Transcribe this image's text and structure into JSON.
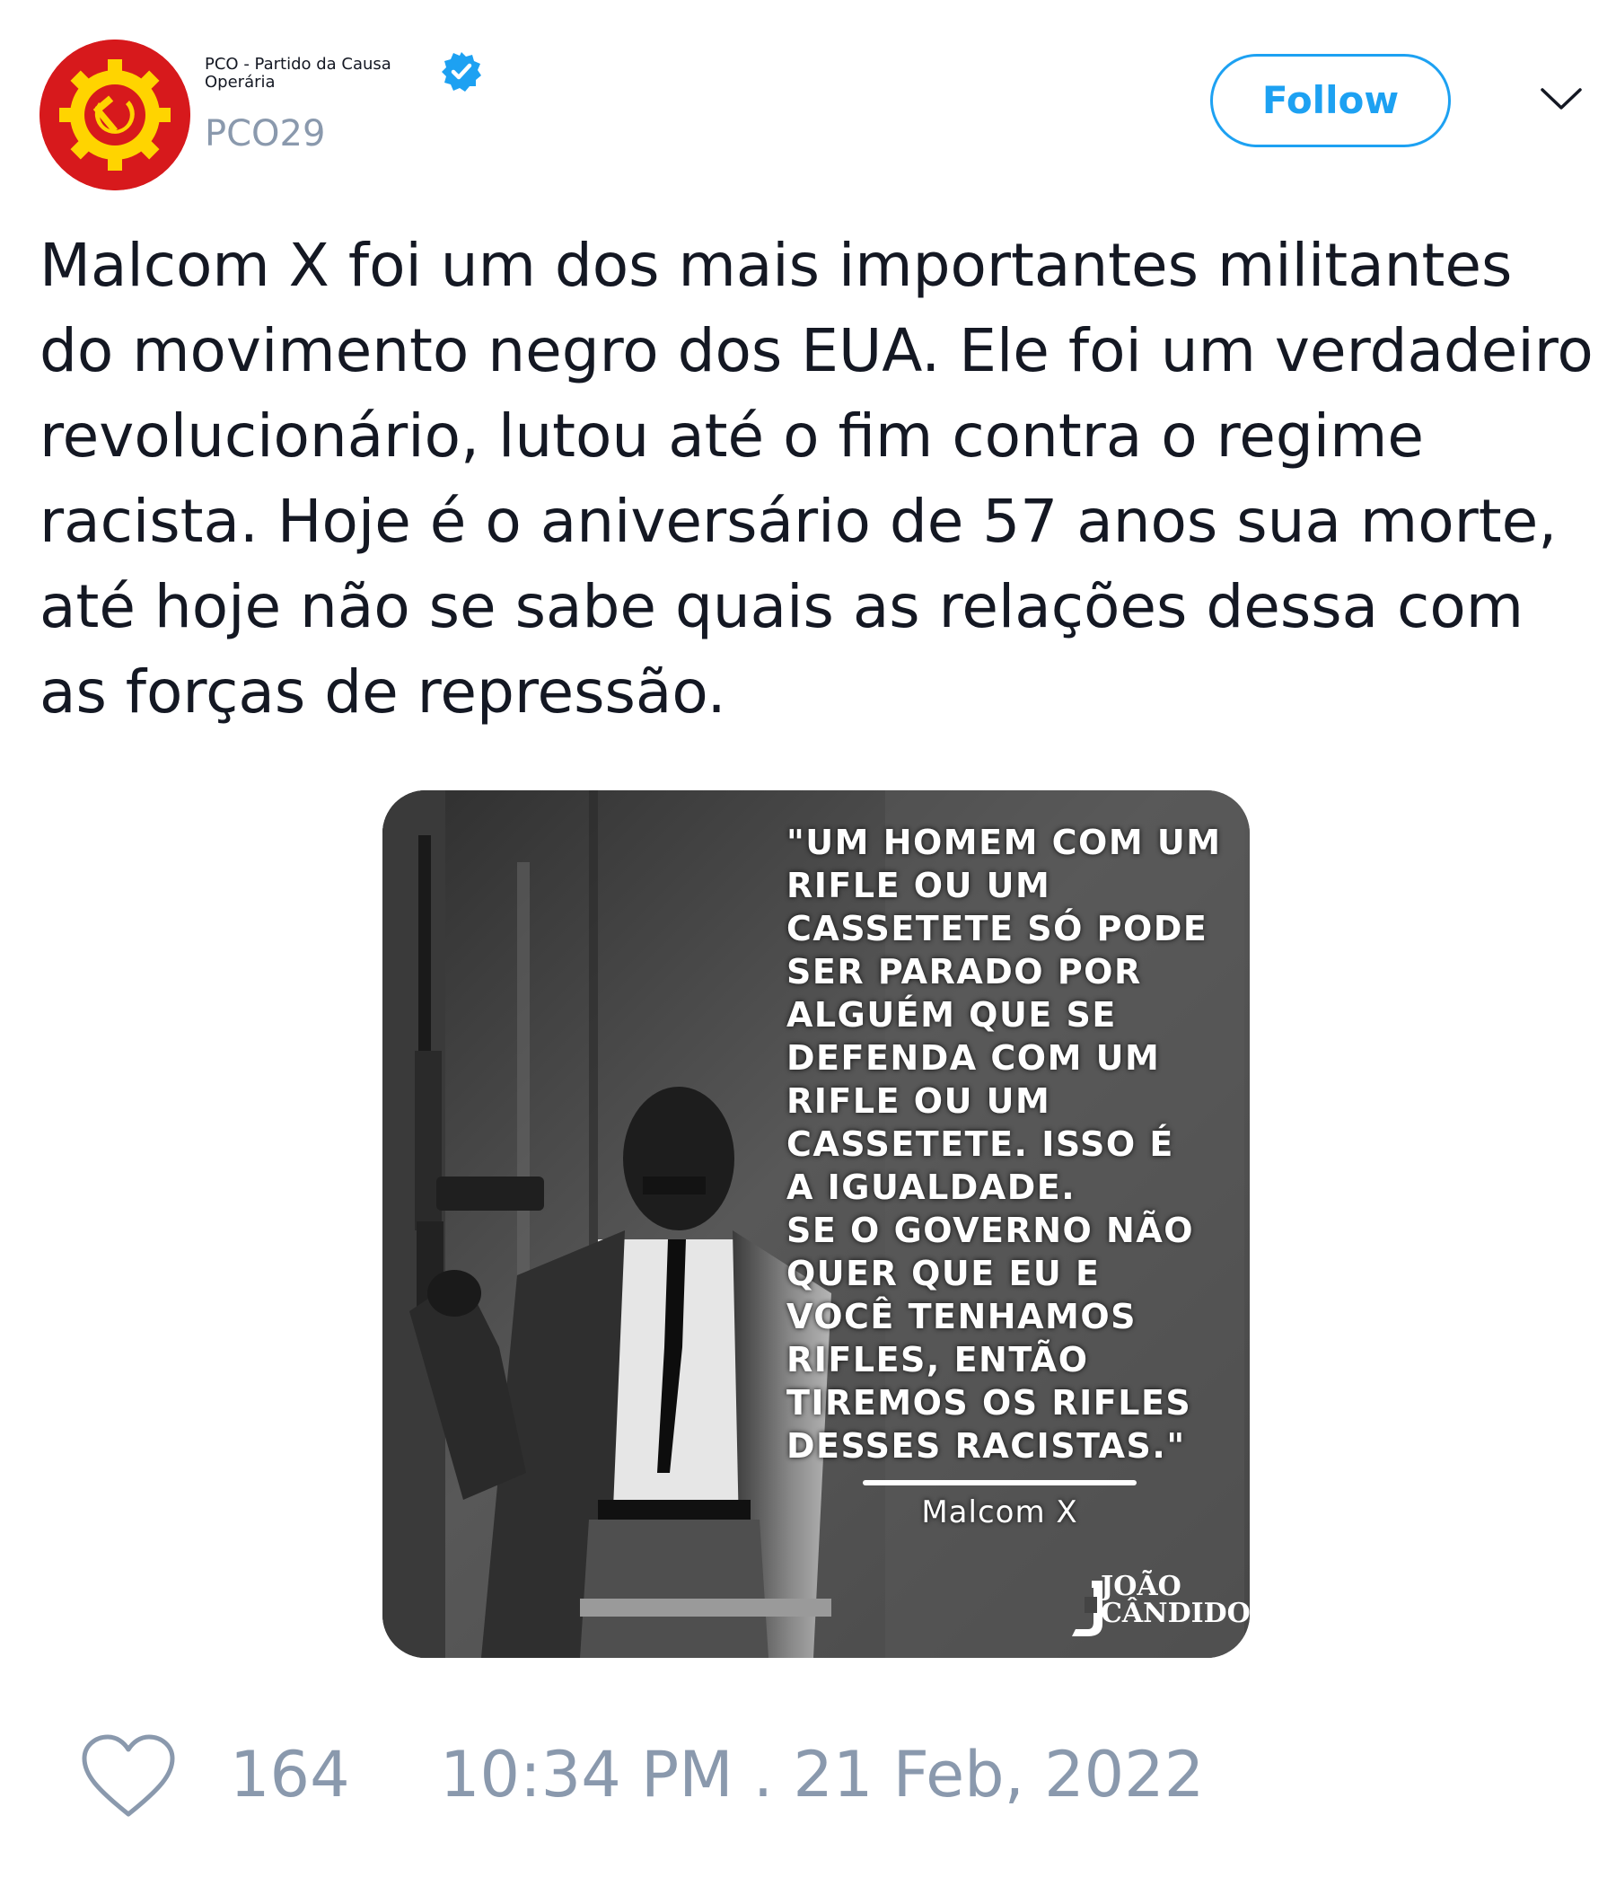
{
  "author": {
    "display_name": "PCO - Partido da Causa Operária",
    "handle": "PCO29",
    "verified": true,
    "avatar_icon": "hammer-sickle-gear-logo"
  },
  "header": {
    "follow_label": "Follow",
    "menu_icon": "chevron-down-icon"
  },
  "tweet": {
    "text": "Malcom X foi um dos mais importantes militantes do movimento negro dos EUA. Ele foi um verdadeiro revolucionário, lutou até o fim contra o regime racista. Hoje é o aniversário de 57 anos sua morte, até hoje não se sabe quais as relações dessa com as forças de repressão."
  },
  "media": {
    "quote": "\"UM HOMEM COM UM\nRIFLE OU UM\nCASSETETE SÓ PODE\nSER PARADO POR\nALGUÉM QUE SE\nDEFENDA COM UM\nRIFLE OU UM\nCASSETETE. ISSO É\nA IGUALDADE.\nSE O GOVERNO NÃO\nQUER QUE EU E\nVOCÊ TENHAMOS\nRIFLES, ENTÃO\nTIREMOS OS RIFLES\nDESSES RACISTAS.\"",
    "author": "Malcom X",
    "logo_text": "JOÃO\nCÂNDIDO"
  },
  "footer": {
    "like_icon": "heart-icon",
    "like_count": "164",
    "timestamp": "10:34 PM . 21 Feb, 2022"
  },
  "colors": {
    "accent": "#1da1f2",
    "muted": "#8a99ad",
    "avatar_red": "#d7191c",
    "avatar_yellow": "#ffd400"
  }
}
